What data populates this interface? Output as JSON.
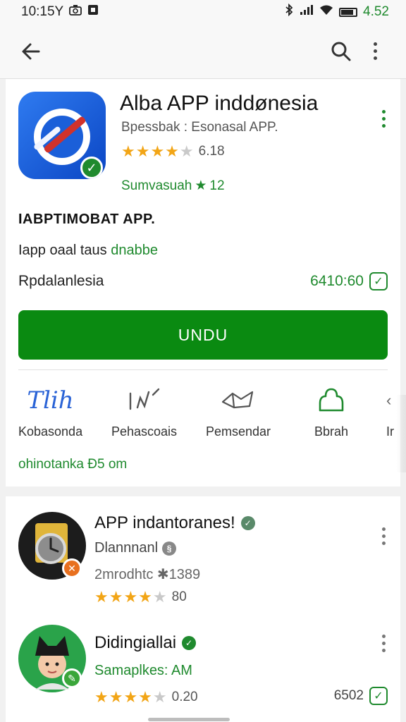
{
  "status_bar": {
    "time": "10:15Y",
    "battery_text": "4.52",
    "icons": [
      "camera-icon",
      "notification-icon",
      "bluetooth-icon",
      "signal-icon",
      "wifi-icon",
      "battery-icon"
    ]
  },
  "app_bar": {
    "icons": [
      "back-arrow-icon",
      "search-icon",
      "more-vert-icon"
    ]
  },
  "app": {
    "title": "Alba APP inddønesia",
    "subtitle": "Bpessbak : Esonasal APP.",
    "stars_filled": 4,
    "stars_half": 1,
    "rating_value": "6.18",
    "installs_label": "Sumvasuah",
    "installs_value": "12",
    "section_title": "IABPTIMOBAT APP.",
    "desc_prefix": "Iapp oaal taus",
    "desc_green": "dnabbe",
    "location_label": "Rpdalanlesia",
    "time_value": "6410:60",
    "install_button": "UNDU",
    "size_text": "ohinotanka  Ð5 om",
    "colors": {
      "accent": "#0a8a11",
      "star": "#f2a516",
      "link": "#1f8a2e"
    }
  },
  "actions": [
    {
      "icon_text": "Tlih",
      "label": "Kobasonda"
    },
    {
      "icon_text": "",
      "label": "Pehascoais"
    },
    {
      "icon_text": "",
      "label": "Pemsendar"
    },
    {
      "icon_text": "",
      "label": "Bbrah"
    },
    {
      "icon_text": "",
      "label": "Ir"
    }
  ],
  "related": [
    {
      "title": "APP indantoranes!",
      "subtitle": "Dlannnanl",
      "meta": "2mrodhtc ✱1389",
      "stars_filled": 4,
      "rating_value": "80"
    },
    {
      "title": "Didingiallai",
      "subtitle": "Samaplkes: AM",
      "meta": "",
      "stars_filled": 4,
      "rating_value": "0.20",
      "trailing_value": "6502"
    }
  ]
}
